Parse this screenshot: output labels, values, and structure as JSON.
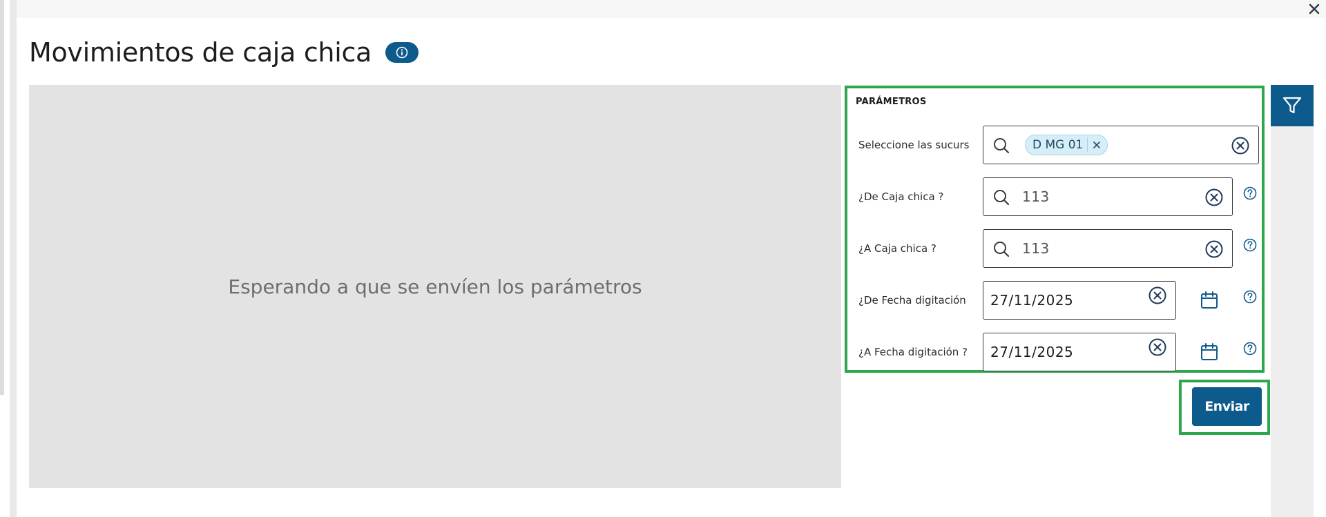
{
  "window": {
    "close_icon": "close-icon"
  },
  "header": {
    "title": "Movimientos de caja chica",
    "info_icon": "info-icon"
  },
  "report": {
    "placeholder": "Esperando a que se envíen los parámetros"
  },
  "parameters": {
    "section_title": "PARÁMETROS",
    "branches": {
      "label": "Seleccione las sucursa...",
      "chips": [
        "D MG 01"
      ]
    },
    "from_petty_cash": {
      "label": "¿De Caja chica ?",
      "value": "113"
    },
    "to_petty_cash": {
      "label": "¿A Caja chica ?",
      "value": "113"
    },
    "from_date": {
      "label": "¿De Fecha digitación ?",
      "value": "27/11/2025"
    },
    "to_date": {
      "label": "¿A Fecha digitación ?",
      "value": "27/11/2025"
    }
  },
  "actions": {
    "send_label": "Enviar"
  },
  "sidebar": {
    "filter_icon": "filter-icon"
  },
  "colors": {
    "primary": "#0d5a8c",
    "highlight": "#2ea64d",
    "report_bg": "#e3e3e3",
    "chip_bg": "#d6eef8"
  }
}
